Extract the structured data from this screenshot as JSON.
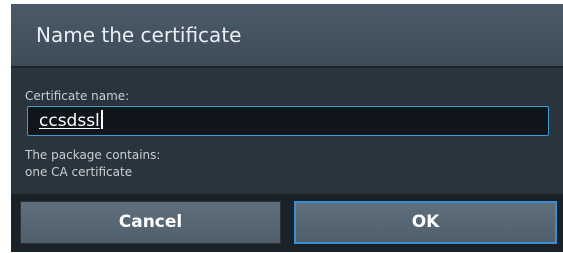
{
  "dialog": {
    "title": "Name the certificate",
    "field_label": "Certificate name:",
    "certificate_name": "ccsdssl",
    "package_info_line1": "The package contains:",
    "package_info_line2": "one CA certificate",
    "cancel_label": "Cancel",
    "ok_label": "OK"
  },
  "colors": {
    "title_bar": "#45535f",
    "dialog_background": "#2a343d",
    "input_focus_border": "#3f9bd0",
    "button_focus_border": "#3a8fd4"
  }
}
